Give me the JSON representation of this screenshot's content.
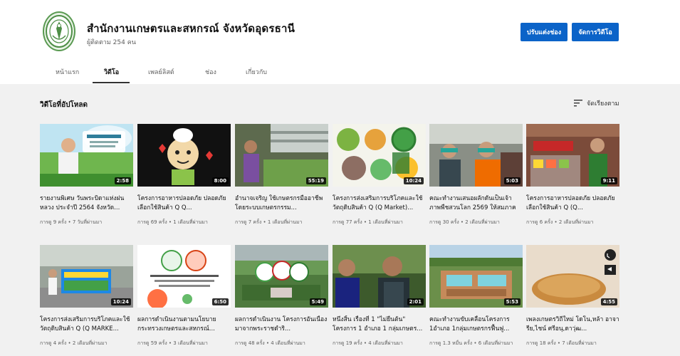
{
  "channel": {
    "name": "สำนักงานเกษตรและสหกรณ์ จังหวัดอุดรธานี",
    "subscribers": "ผู้ติดตาม 254 คน",
    "avatar_icon": "government-seal-icon"
  },
  "buttons": {
    "customize": "ปรับแต่งช่อง",
    "manage": "จัดการวิดีโอ"
  },
  "tabs": [
    {
      "label": "หน้าแรก",
      "active": false
    },
    {
      "label": "วิดีโอ",
      "active": true
    },
    {
      "label": "เพลย์ลิสต์",
      "active": false
    },
    {
      "label": "ช่อง",
      "active": false
    },
    {
      "label": "เกี่ยวกับ",
      "active": false
    }
  ],
  "section": {
    "title": "วิดีโอที่อัปโหลด",
    "sort_label": "จัดเรียงตาม",
    "sort_icon": "sort-icon"
  },
  "colors": {
    "accent": "#0b63c8",
    "background": "#f1f1f1"
  },
  "videos": [
    {
      "title": "รายงานพิเศษ วันพระบิดาแห่งฝนหลวง ประจำปี 2564 จังหวัด...",
      "meta": "การดู 9 ครั้ง • 7 วันที่ผ่านมา",
      "duration": "2:58"
    },
    {
      "title": "โครงการอาหารปลอดภัย ปลอดภัย เลือกใช้สินค้า Q Q...",
      "meta": "การดู 69 ครั้ง • 1 เดือนที่ผ่านมา",
      "duration": "8:00"
    },
    {
      "title": "อำนาจเจริญ ใช้เกษตรกรมืออาชีพ โดยระบบเกษตรกรรม...",
      "meta": "การดู 7 ครั้ง • 1 เดือนที่ผ่านมา",
      "duration": "55:19"
    },
    {
      "title": "โครงการส่งเสริมการบริโภคและใช้วัตถุดิบสินค้า Q (Q Market)...",
      "meta": "การดู 77 ครั้ง • 1 เดือนที่ผ่านมา",
      "duration": "10:24"
    },
    {
      "title": "คณะทำงานเสนอผลักดันเป็นเจ้าภาพพืชสวนโลก 2569 ให้สมภาคพ...",
      "meta": "การดู 30 ครั้ง • 2 เดือนที่ผ่านมา",
      "duration": "5:03"
    },
    {
      "title": "โครงการอาหารปลอดภัย ปลอดภัย เลือกใช้สินค้า Q (Q...",
      "meta": "การดู 6 ครั้ง • 2 เดือนที่ผ่านมา",
      "duration": "9:11"
    },
    {
      "title": "โครงการส่งเสริมการบริโภคและใช้วัตถุดิบสินค้า Q (Q MARKE...",
      "meta": "การดู 4 ครั้ง • 2 เดือนที่ผ่านมา",
      "duration": "10:24"
    },
    {
      "title": "ผลการดำเนินงานตามนโยบายกระทรวงเกษตรและสหกรณ์...",
      "meta": "การดู 59 ครั้ง • 3 เดือนที่ผ่านมา",
      "duration": "6:50"
    },
    {
      "title": "ผลการดำเนินงาน โครงการอันเนื่องมาจากพระราชดำริ...",
      "meta": "การดู 48 ครั้ง • 4 เดือนที่ผ่านมา",
      "duration": "5:49"
    },
    {
      "title": "หนึ่งสิ้น เรื่องที่ 1 \"ไม่ยืนต้น\" โครงการ 1 อำเภอ 1 กลุ่มเกษตร...",
      "meta": "การดู 19 ครั้ง • 4 เดือนที่ผ่านมา",
      "duration": "2:01"
    },
    {
      "title": "คณะทำงานขับเคลื่อนโครงการ 1อำเภอ 1กลุ่มเกษตรกรฟื้นฟู...",
      "meta": "การดู 1.3 หมื่น ครั้ง • 6 เดือนที่ผ่านมา",
      "duration": "5:53"
    },
    {
      "title": "เพลงเกษตรวิถีใหม่ โดโน,หล้า อาจารีย,ไชน์ ศรีอนุ,ดาวุ่ฒ...",
      "meta": "การดู 18 ครั้ง • 7 เดือนที่ผ่านมา",
      "duration": "4:55"
    }
  ]
}
